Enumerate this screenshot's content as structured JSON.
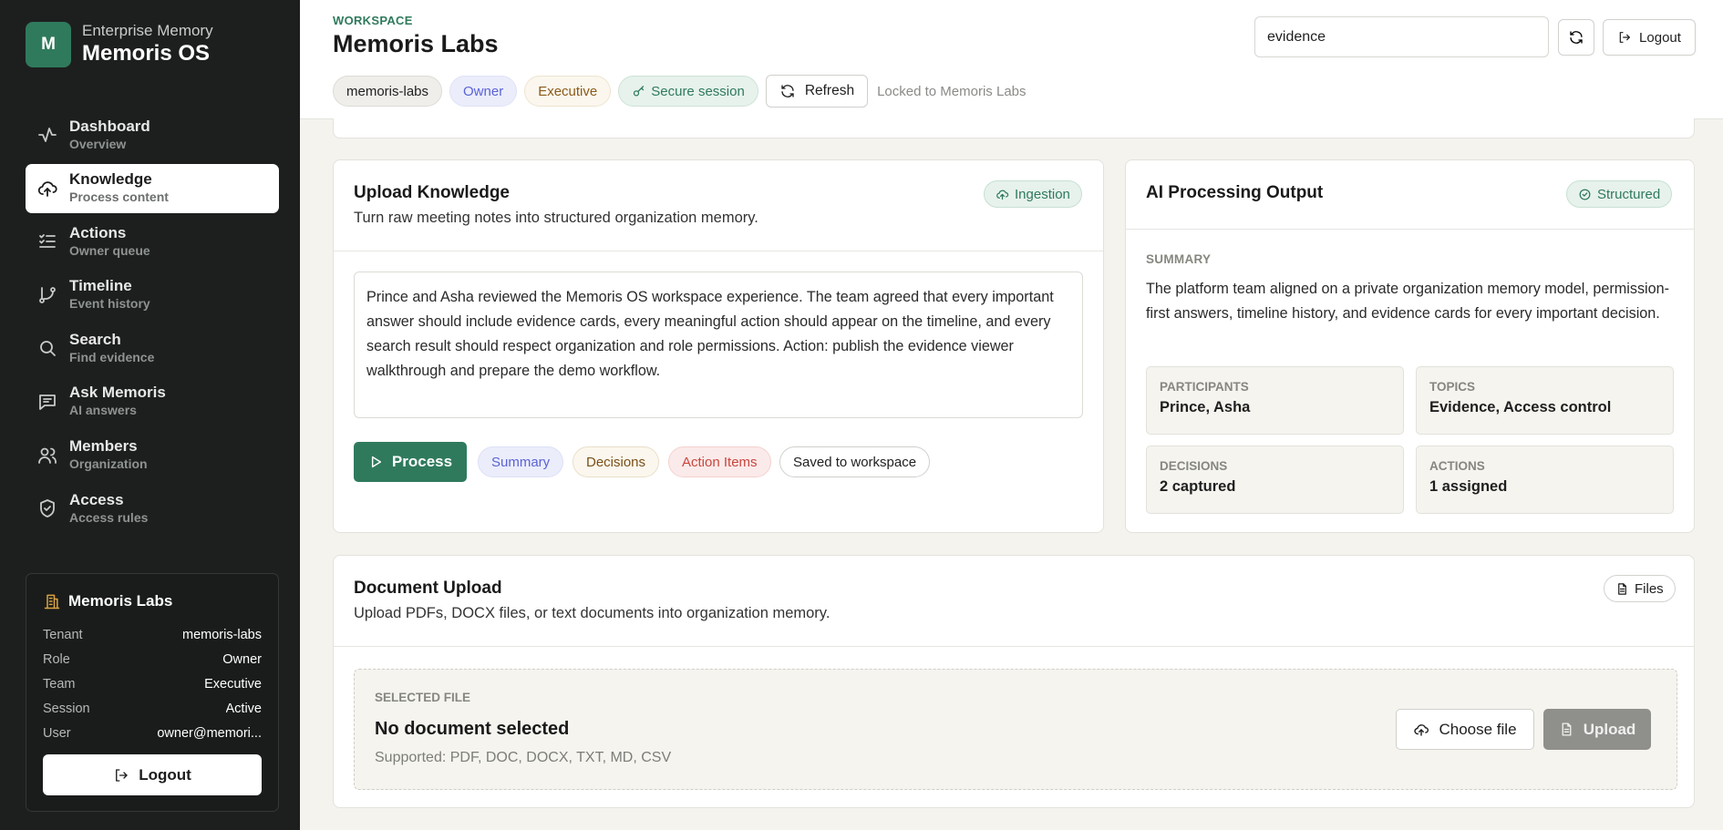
{
  "brand": {
    "initial": "M",
    "subtitle": "Enterprise Memory",
    "title": "Memoris OS",
    "accent": "#2f7a5d"
  },
  "nav": [
    {
      "label": "Dashboard",
      "sub": "Overview",
      "icon": "activity-icon"
    },
    {
      "label": "Knowledge",
      "sub": "Process content",
      "icon": "cloud-upload-icon",
      "active": true
    },
    {
      "label": "Actions",
      "sub": "Owner queue",
      "icon": "checklist-icon"
    },
    {
      "label": "Timeline",
      "sub": "Event history",
      "icon": "git-branch-icon"
    },
    {
      "label": "Search",
      "sub": "Find evidence",
      "icon": "search-icon"
    },
    {
      "label": "Ask Memoris",
      "sub": "AI answers",
      "icon": "message-icon"
    },
    {
      "label": "Members",
      "sub": "Organization",
      "icon": "users-icon"
    },
    {
      "label": "Access",
      "sub": "Access rules",
      "icon": "shield-check-icon"
    }
  ],
  "org": {
    "name": "Memoris Labs",
    "rows": [
      {
        "key": "Tenant",
        "value": "memoris-labs"
      },
      {
        "key": "Role",
        "value": "Owner"
      },
      {
        "key": "Team",
        "value": "Executive"
      },
      {
        "key": "Session",
        "value": "Active"
      },
      {
        "key": "User",
        "value": "owner@memori..."
      }
    ],
    "logout_label": "Logout"
  },
  "header": {
    "eyebrow": "WORKSPACE",
    "title": "Memoris Labs",
    "chips": {
      "tenant": "memoris-labs",
      "role": "Owner",
      "team": "Executive",
      "secure": "Secure session"
    },
    "refresh_label": "Refresh",
    "locked_text": "Locked to Memoris Labs",
    "search_value": "evidence",
    "logout_label": "Logout"
  },
  "upload": {
    "title": "Upload Knowledge",
    "subtitle": "Turn raw meeting notes into structured organization memory.",
    "badge": "Ingestion",
    "notes": "Prince and Asha reviewed the Memoris OS workspace experience. The team agreed that every important answer should include evidence cards, every meaningful action should appear on the timeline, and every search result should respect organization and role permissions. Action: publish the evidence viewer walkthrough and prepare the demo workflow.",
    "process_label": "Process",
    "pills": {
      "summary": "Summary",
      "decisions": "Decisions",
      "actions": "Action Items",
      "saved": "Saved to workspace"
    }
  },
  "output": {
    "title": "AI Processing Output",
    "badge": "Structured",
    "summary_label": "SUMMARY",
    "summary": "The platform team aligned on a private organization memory model, permission-first answers, timeline history, and evidence cards for every important decision.",
    "stats": [
      {
        "key": "PARTICIPANTS",
        "value": "Prince, Asha"
      },
      {
        "key": "TOPICS",
        "value": "Evidence, Access control"
      },
      {
        "key": "DECISIONS",
        "value": "2 captured"
      },
      {
        "key": "ACTIONS",
        "value": "1 assigned"
      }
    ]
  },
  "document": {
    "title": "Document Upload",
    "subtitle": "Upload PDFs, DOCX files, or text documents into organization memory.",
    "badge": "Files",
    "selected_label": "SELECTED FILE",
    "selected_value": "No document selected",
    "supported": "Supported: PDF, DOC, DOCX, TXT, MD, CSV",
    "choose_label": "Choose file",
    "upload_label": "Upload"
  }
}
